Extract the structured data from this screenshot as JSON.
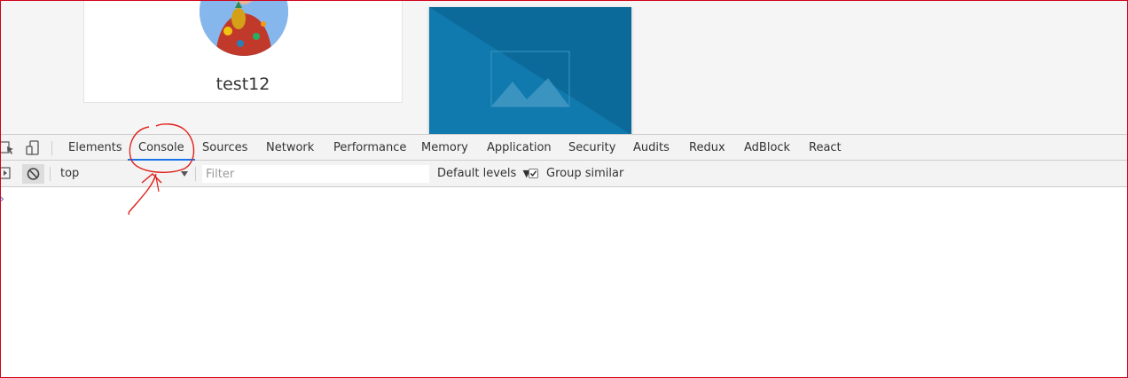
{
  "page": {
    "username": "test12"
  },
  "devtools": {
    "tabs": [
      {
        "label": "Elements"
      },
      {
        "label": "Console"
      },
      {
        "label": "Sources"
      },
      {
        "label": "Network"
      },
      {
        "label": "Performance"
      },
      {
        "label": "Memory"
      },
      {
        "label": "Application"
      },
      {
        "label": "Security"
      },
      {
        "label": "Audits"
      },
      {
        "label": "Redux"
      },
      {
        "label": "AdBlock"
      },
      {
        "label": "React"
      }
    ],
    "active_tab": "Console",
    "context": "top",
    "filter_placeholder": "Filter",
    "levels_label": "Default levels",
    "group_similar_label": "Group similar",
    "group_similar_checked": true,
    "prompt_symbol": "›"
  },
  "colors": {
    "accent": "#1a73e8",
    "annotation": "#e0201a",
    "image_placeholder": "#1079ad"
  },
  "icons": [
    "inspect-element-icon",
    "device-toolbar-icon",
    "sidebar-toggle-icon",
    "clear-console-icon",
    "checkbox-check-icon",
    "dropdown-arrow-icon",
    "image-placeholder-icon"
  ]
}
